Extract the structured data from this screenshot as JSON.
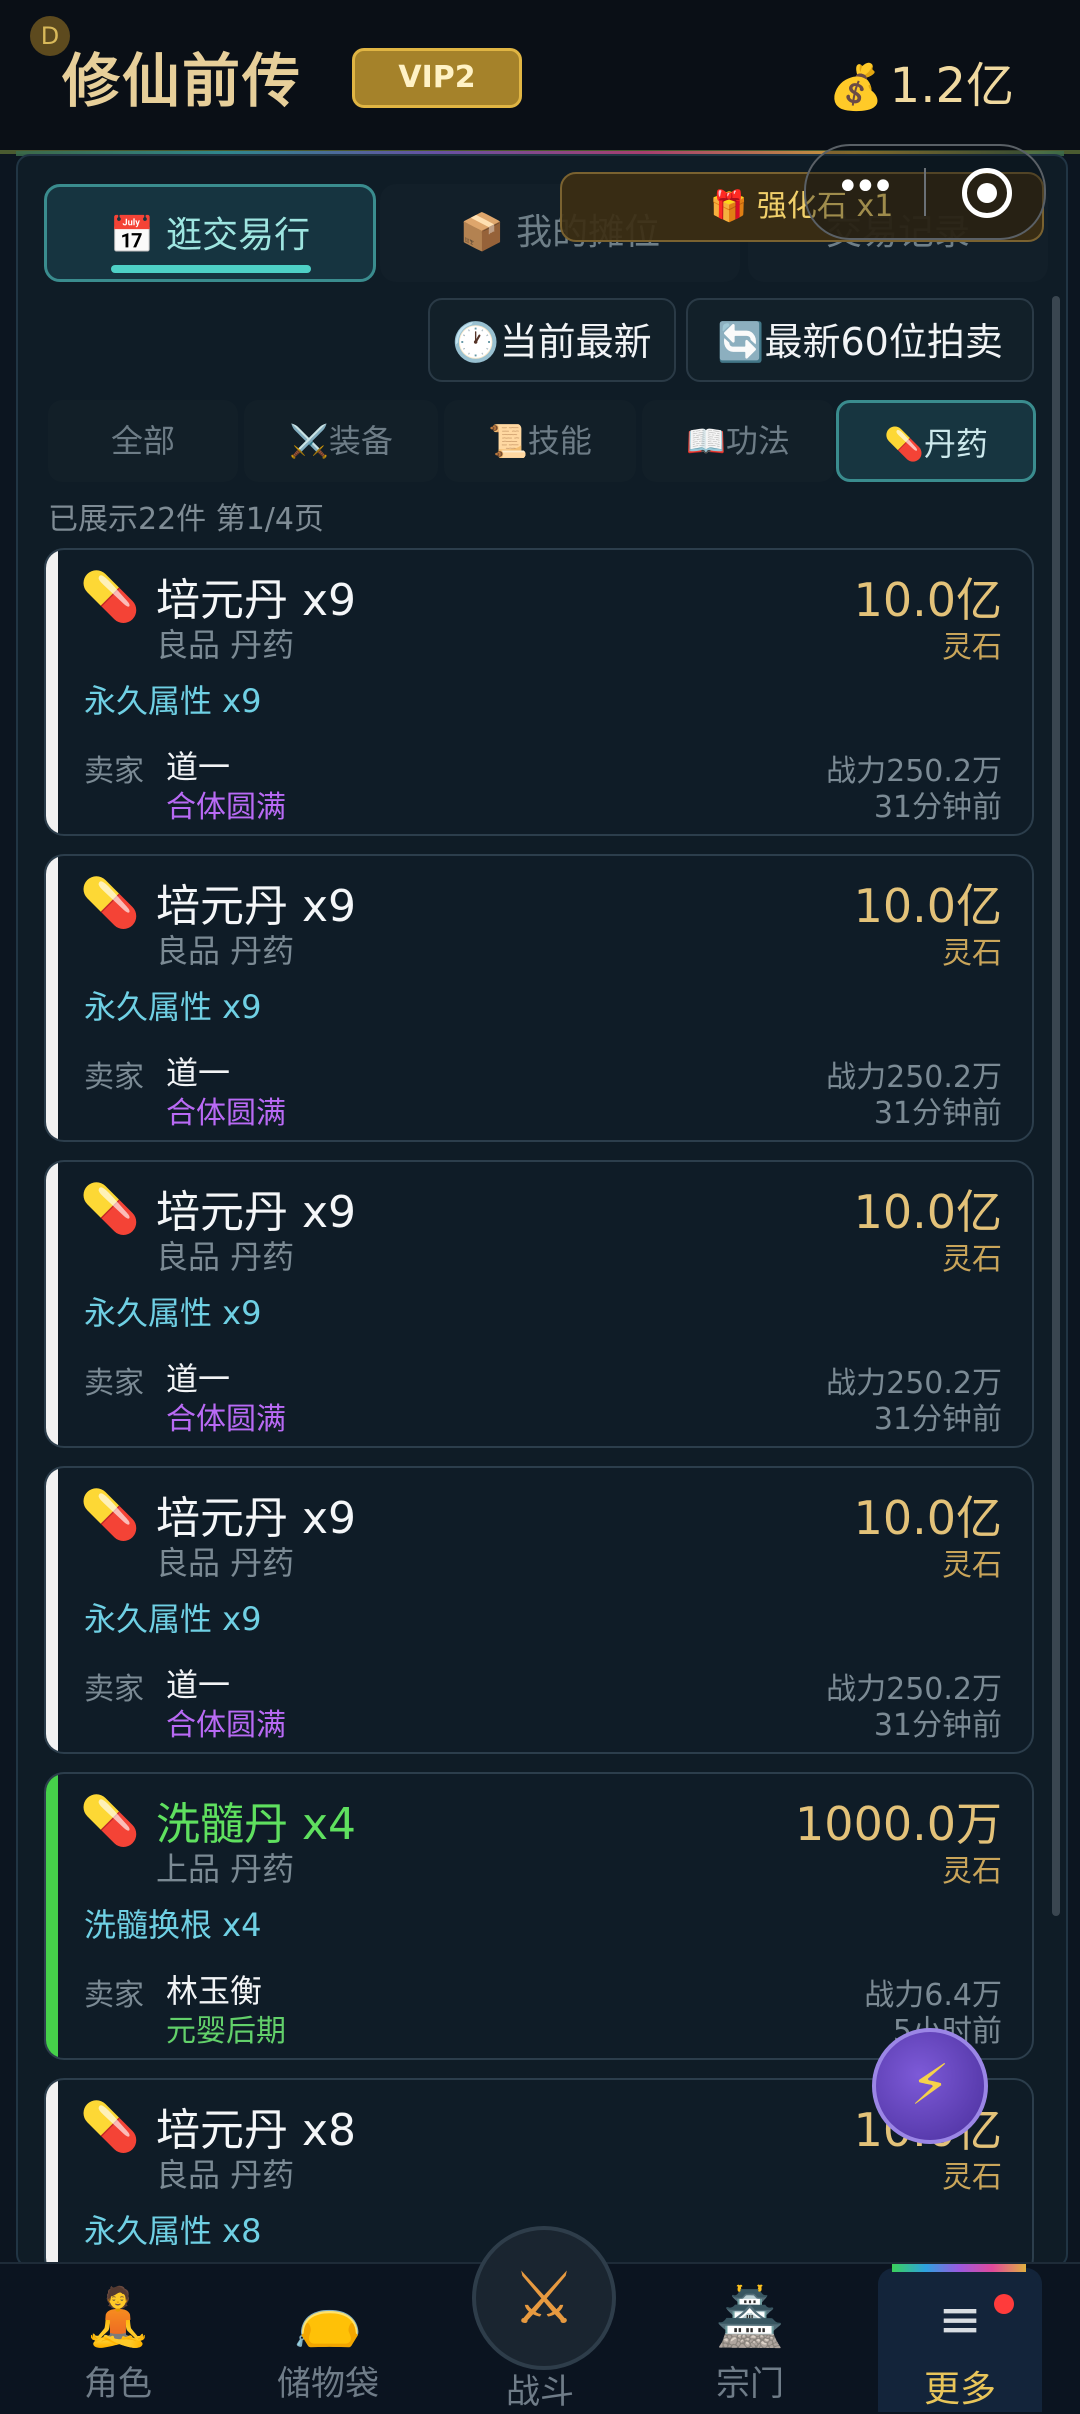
{
  "header": {
    "title": "修仙前传",
    "vip": "VIP2",
    "currency": "1.2亿",
    "avatar_letter": "D"
  },
  "tabs": {
    "active": "逛交易行",
    "active_icon": "📅",
    "second": "我的摊位",
    "second_icon": "📦",
    "third_partial": "交易记录"
  },
  "overlay": {
    "gift_label": "强化石 x1"
  },
  "sort_buttons": {
    "latest": "当前最新",
    "auction": "最新60位拍卖"
  },
  "categories": [
    {
      "label": "全部",
      "icon": ""
    },
    {
      "label": "装备",
      "icon": "⚔️"
    },
    {
      "label": "技能",
      "icon": "📜"
    },
    {
      "label": "功法",
      "icon": "📖"
    },
    {
      "label": "丹药",
      "icon": "💊"
    }
  ],
  "count_text": "已展示22件  第1/4页",
  "listings": [
    {
      "name": "培元丹 x9",
      "quality": "良品 丹药",
      "attr": "永久属性 x9",
      "seller_label": "卖家",
      "seller": "道一",
      "realm": "合体圆满",
      "price": "10.0亿",
      "unit": "灵石",
      "power": "战力250.2万",
      "time": "31分钟前"
    },
    {
      "name": "培元丹 x9",
      "quality": "良品 丹药",
      "attr": "永久属性 x9",
      "seller_label": "卖家",
      "seller": "道一",
      "realm": "合体圆满",
      "price": "10.0亿",
      "unit": "灵石",
      "power": "战力250.2万",
      "time": "31分钟前"
    },
    {
      "name": "培元丹 x9",
      "quality": "良品 丹药",
      "attr": "永久属性 x9",
      "seller_label": "卖家",
      "seller": "道一",
      "realm": "合体圆满",
      "price": "10.0亿",
      "unit": "灵石",
      "power": "战力250.2万",
      "time": "31分钟前"
    },
    {
      "name": "培元丹 x9",
      "quality": "良品 丹药",
      "attr": "永久属性 x9",
      "seller_label": "卖家",
      "seller": "道一",
      "realm": "合体圆满",
      "price": "10.0亿",
      "unit": "灵石",
      "power": "战力250.2万",
      "time": "31分钟前"
    },
    {
      "name": "洗髓丹 x4",
      "quality": "上品 丹药",
      "attr": "洗髓换根 x4",
      "seller_label": "卖家",
      "seller": "林玉衡",
      "realm": "元婴后期",
      "price": "1000.0万",
      "unit": "灵石",
      "power": "战力6.4万",
      "time": "5小时前"
    },
    {
      "name": "培元丹 x8",
      "quality": "良品 丹药",
      "attr": "永久属性 x8",
      "seller_label": "",
      "seller": "",
      "realm": "",
      "price": "10.0亿",
      "unit": "灵石",
      "power": "",
      "time": ""
    }
  ],
  "bottom_nav": [
    {
      "label": "角色",
      "icon": "meditation-icon"
    },
    {
      "label": "储物袋",
      "icon": "bag-icon"
    },
    {
      "label": "战斗",
      "icon": "swords-icon"
    },
    {
      "label": "宗门",
      "icon": "temple-icon"
    },
    {
      "label": "更多",
      "icon": "menu-icon"
    }
  ]
}
